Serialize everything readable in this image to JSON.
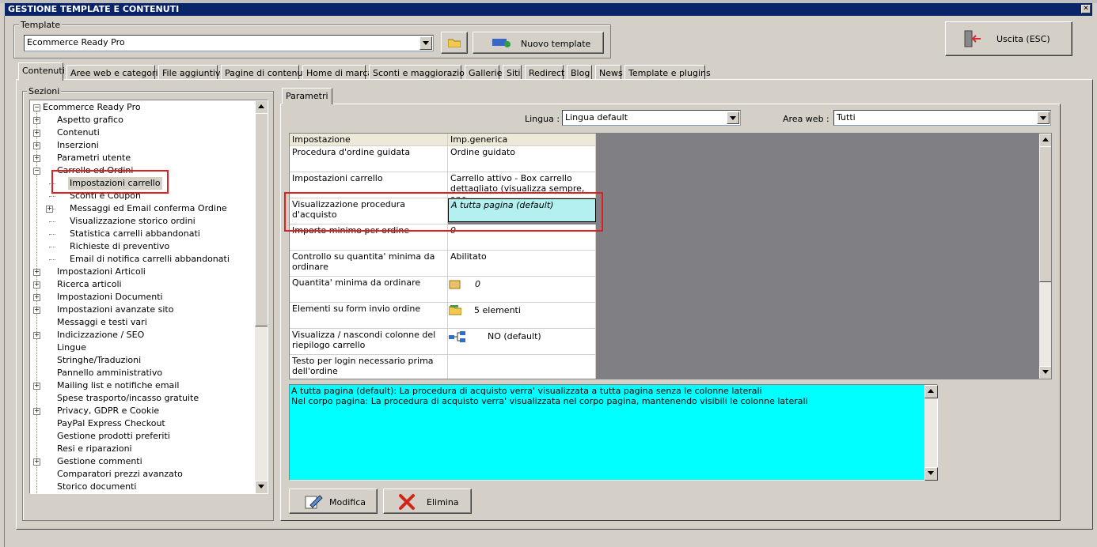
{
  "window": {
    "title": "GESTIONE TEMPLATE E CONTENUTI",
    "close_glyph": "✕"
  },
  "template_group": {
    "label": "Template",
    "selected": "Ecommerce Ready Pro",
    "new_button": "Nuovo template"
  },
  "exit_button": "Uscita (ESC)",
  "tabs": [
    "Contenuti",
    "Aree web e categorie",
    "File aggiuntivi",
    "Pagine di contenuti",
    "Home di marca",
    "Sconti e maggiorazioni",
    "Gallerie",
    "Siti",
    "Redirect",
    "Blog",
    "News",
    "Template e plugins"
  ],
  "sections": {
    "label": "Sezioni",
    "root": "Ecommerce Ready Pro",
    "items": [
      {
        "label": "Aspetto grafico",
        "level": 1,
        "expandable": true
      },
      {
        "label": "Contenuti",
        "level": 1,
        "expandable": true
      },
      {
        "label": "Inserzioni",
        "level": 1,
        "expandable": true
      },
      {
        "label": "Parametri utente",
        "level": 1,
        "expandable": true
      },
      {
        "label": "Carrello ed Ordini",
        "level": 1,
        "expandable": true,
        "expanded": true
      },
      {
        "label": "Impostazioni carrello",
        "level": 2,
        "selected": true
      },
      {
        "label": "Sconti e Coupon",
        "level": 2
      },
      {
        "label": "Messaggi ed Email conferma Ordine",
        "level": 2,
        "expandable": true
      },
      {
        "label": "Visualizzazione storico ordini",
        "level": 2
      },
      {
        "label": "Statistica carrelli abbandonati",
        "level": 2
      },
      {
        "label": "Richieste di preventivo",
        "level": 2
      },
      {
        "label": "Email di notifica carrelli abbandonati",
        "level": 2
      },
      {
        "label": "Impostazioni Articoli",
        "level": 1,
        "expandable": true
      },
      {
        "label": "Ricerca articoli",
        "level": 1,
        "expandable": true
      },
      {
        "label": "Impostazioni Documenti",
        "level": 1,
        "expandable": true
      },
      {
        "label": "Impostazioni avanzate sito",
        "level": 1,
        "expandable": true
      },
      {
        "label": "Messaggi e testi vari",
        "level": 1
      },
      {
        "label": "Indicizzazione / SEO",
        "level": 1,
        "expandable": true
      },
      {
        "label": "Lingue",
        "level": 1
      },
      {
        "label": "Stringhe/Traduzioni",
        "level": 1
      },
      {
        "label": "Pannello amministrativo",
        "level": 1
      },
      {
        "label": "Mailing list e notifiche email",
        "level": 1,
        "expandable": true
      },
      {
        "label": "Spese trasporto/incasso gratuite",
        "level": 1
      },
      {
        "label": "Privacy, GDPR e Cookie",
        "level": 1,
        "expandable": true
      },
      {
        "label": "PayPal Express Checkout",
        "level": 1
      },
      {
        "label": "Gestione prodotti preferiti",
        "level": 1
      },
      {
        "label": "Resi e riparazioni",
        "level": 1
      },
      {
        "label": "Gestione commenti",
        "level": 1,
        "expandable": true
      },
      {
        "label": "Comparatori prezzi avanzato",
        "level": 1
      },
      {
        "label": "Storico documenti",
        "level": 1
      }
    ]
  },
  "params": {
    "tab_label": "Parametri",
    "lingua_label": "Lingua :",
    "lingua_value": "Lingua default",
    "area_label": "Area web :",
    "area_value": "Tutti",
    "columns": [
      "Impostazione",
      "Imp.generica"
    ],
    "rows": [
      {
        "name": "Procedura d'ordine guidata",
        "value": "Ordine guidato",
        "icon": ""
      },
      {
        "name": "Impostazioni carrello",
        "value": "Carrello attivo - Box carrello dettagliato (visualizza sempre, anc...",
        "icon": ""
      },
      {
        "name": "Visualizzazione procedura d'acquisto",
        "value": "A tutta pagina (default)",
        "icon": "",
        "selected": true
      },
      {
        "name": "Importo minimo per ordine",
        "value": "0",
        "icon": ""
      },
      {
        "name": "Controllo su quantita' minima da ordinare",
        "value": "Abilitato",
        "icon": ""
      },
      {
        "name": "Quantita' minima da ordinare",
        "value": "0",
        "icon": "box-icon"
      },
      {
        "name": "Elementi su form invio ordine",
        "value": "5 elementi",
        "icon": "folder-icon"
      },
      {
        "name": "Visualizza / nascondi colonne del riepilogo carrello",
        "value": "NO (default)",
        "icon": "tree-icon"
      },
      {
        "name": "Testo per login necessario prima dell'ordine",
        "value": "",
        "icon": ""
      }
    ],
    "description_lines": [
      "A tutta pagina (default): La procedura di acquisto verra' visualizzata a tutta pagina senza le colonne laterali",
      "Nel corpo pagina: La procedura di acquisto verra' visualizzata nel corpo pagina, mantenendo visibili le colonne laterali"
    ],
    "modify_button": "Modifica",
    "delete_button": "Elimina"
  },
  "colors": {
    "titlebar": "#0a246a",
    "selected_cell": "#b4f0f0",
    "description_bg": "#00ffff",
    "highlight": "#e02020"
  }
}
